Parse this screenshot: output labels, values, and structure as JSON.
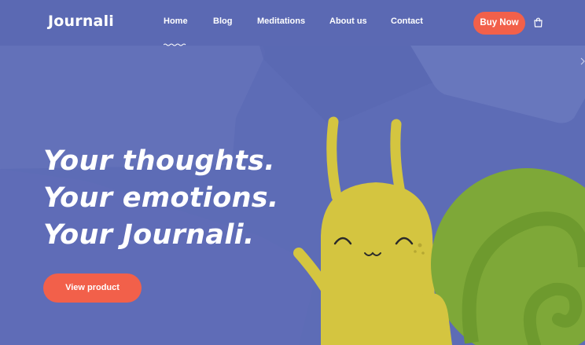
{
  "header": {
    "logo": "Journali",
    "nav": [
      {
        "label": "Home",
        "active": true
      },
      {
        "label": "Blog",
        "active": false
      },
      {
        "label": "Meditations",
        "active": false
      },
      {
        "label": "About us",
        "active": false
      },
      {
        "label": "Contact",
        "active": false
      }
    ],
    "buy_label": "Buy Now",
    "cart_icon": "shopping-bag-icon"
  },
  "hero": {
    "lines": [
      "Your thoughts.",
      "Your emotions.",
      "Your Journali."
    ],
    "cta_label": "View product"
  },
  "colors": {
    "background": "#5d6cb6",
    "header": "#5b69b3",
    "accent": "#f2604a",
    "snail_body": "#d4c540",
    "snail_shell": "#7ea838"
  }
}
